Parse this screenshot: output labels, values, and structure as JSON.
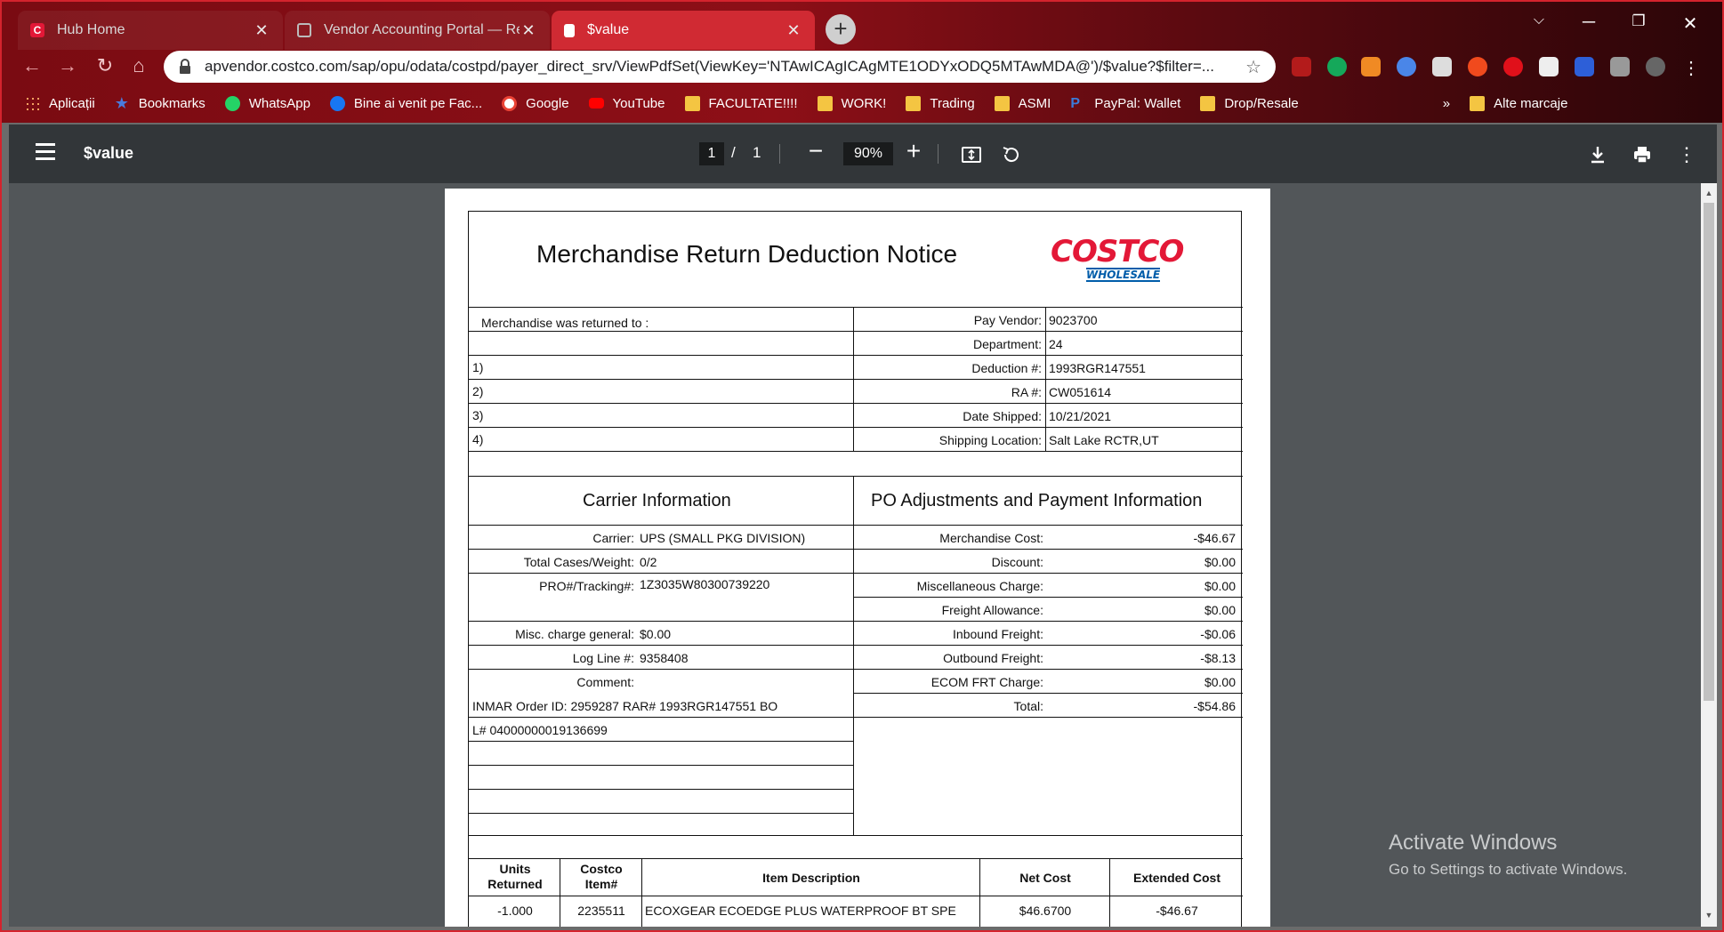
{
  "tabs": [
    {
      "title": "Hub Home",
      "favicon_color": "#e31837"
    },
    {
      "title": "Vendor Accounting Portal — Ret",
      "favicon_color": "#bbbbbb"
    },
    {
      "title": "$value",
      "favicon_color": "#ffffff"
    }
  ],
  "new_tab": "+",
  "address_bar": {
    "url": "apvendor.costco.com/sap/opu/odata/costpd/payer_direct_srv/ViewPdfSet(ViewKey='NTAwICAgICAgMTE1ODYxODQ5MTAwMDA@')/$value?$filter=..."
  },
  "bookmarks": [
    {
      "label": "Aplicații",
      "icon": "apps-grid-icon",
      "color": "#f4a261"
    },
    {
      "label": "Bookmarks",
      "icon": "star-icon",
      "color": "#4a7bdb"
    },
    {
      "label": "WhatsApp",
      "icon": "whatsapp-icon",
      "color": "#25d366"
    },
    {
      "label": "Bine ai venit pe Fac...",
      "icon": "facebook-icon",
      "color": "#1877f2"
    },
    {
      "label": "Google",
      "icon": "google-icon",
      "color": "#ffffff"
    },
    {
      "label": "YouTube",
      "icon": "youtube-icon",
      "color": "#ff0000"
    },
    {
      "label": "FACULTATE!!!!",
      "icon": "folder-icon",
      "color": "#f4c542"
    },
    {
      "label": "WORK!",
      "icon": "folder-icon",
      "color": "#f4c542"
    },
    {
      "label": "Trading",
      "icon": "folder-icon",
      "color": "#f4c542"
    },
    {
      "label": "ASMI",
      "icon": "folder-icon",
      "color": "#f4c542"
    },
    {
      "label": "PayPal: Wallet",
      "icon": "paypal-icon",
      "color": "#1b4fa0"
    },
    {
      "label": "Drop/Resale",
      "icon": "folder-icon",
      "color": "#f4c542"
    }
  ],
  "bookmarks_more": "»",
  "bookmarks_other": "Alte marcaje",
  "pdf_toolbar": {
    "title": "$value",
    "page_current": "1",
    "page_sep": "/",
    "page_total": "1",
    "zoom": "90%"
  },
  "document": {
    "title": "Merchandise Return Deduction Notice",
    "logo_top": "COSTCO",
    "logo_bottom": "WHOLESALE",
    "returned_to_label": "Merchandise was returned to :",
    "returned_lines": [
      "1)",
      "2)",
      "3)",
      "4)"
    ],
    "vendor_fields": [
      {
        "label": "Pay Vendor:",
        "value": "9023700"
      },
      {
        "label": "Department:",
        "value": "24"
      },
      {
        "label": "Deduction #:",
        "value": "1993RGR147551"
      },
      {
        "label": "RA #:",
        "value": "CW051614"
      },
      {
        "label": "Date Shipped:",
        "value": "10/21/2021"
      },
      {
        "label": "Shipping Location:",
        "value": "Salt Lake RCTR,UT"
      }
    ],
    "carrier_heading": "Carrier Information",
    "po_heading": "PO Adjustments and Payment Information",
    "carrier_fields": [
      {
        "label": "Carrier:",
        "value": "UPS (SMALL PKG DIVISION)"
      },
      {
        "label": "Total Cases/Weight:",
        "value": "0/2"
      },
      {
        "label": "PRO#/Tracking#:",
        "value": "1Z3035W80300739220"
      },
      {
        "label": "Misc. charge general:",
        "value": "$0.00"
      },
      {
        "label": "Log Line #:",
        "value": "9358408"
      },
      {
        "label": "Comment:",
        "value": ""
      }
    ],
    "comment_lines": [
      "INMAR Order ID: 2959287 RAR# 1993RGR147551 BO",
      "L# 04000000019136699"
    ],
    "po_fields": [
      {
        "label": "Merchandise Cost:",
        "value": "-$46.67"
      },
      {
        "label": "Discount:",
        "value": "$0.00"
      },
      {
        "label": "Miscellaneous Charge:",
        "value": "$0.00"
      },
      {
        "label": "Freight Allowance:",
        "value": "$0.00"
      },
      {
        "label": "Inbound Freight:",
        "value": "-$0.06"
      },
      {
        "label": "Outbound Freight:",
        "value": "-$8.13"
      },
      {
        "label": "ECOM FRT Charge:",
        "value": "$0.00"
      },
      {
        "label": "Total:",
        "value": "-$54.86"
      }
    ],
    "items_header": {
      "units": "Units Returned",
      "item": "Costco Item#",
      "desc": "Item Description",
      "net": "Net Cost",
      "ext": "Extended Cost"
    },
    "items": [
      {
        "units": "-1.000",
        "item": "2235511",
        "desc": "ECOXGEAR ECOEDGE PLUS WATERPROOF BT SPE",
        "net": "$46.6700",
        "ext": "-$46.67"
      }
    ]
  },
  "activate_windows": {
    "title": "Activate Windows",
    "subtitle": "Go to Settings to activate Windows."
  },
  "colors": {
    "chrome_frame": "#8d0f17",
    "active_tab": "#d02a33",
    "pdf_toolbar": "#323639",
    "viewer_bg": "#525659",
    "costco_red": "#e31837",
    "costco_blue": "#005daa"
  }
}
